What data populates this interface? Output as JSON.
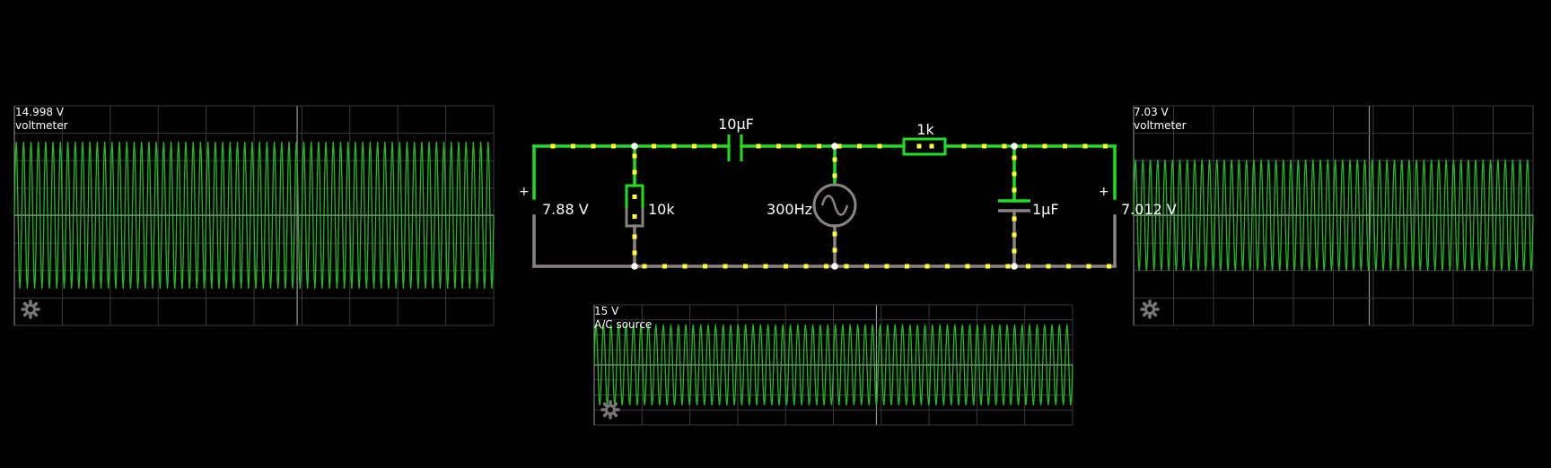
{
  "colors": {
    "background": "#000000",
    "wire_live": "#22dd22",
    "wire_ground": "#8a8280",
    "current_dot": "#ffff33",
    "node": "#ffffff",
    "scope_wave": "#22bb22",
    "scope_grid": "#3a3a3a",
    "scope_axis": "#999999",
    "scope_zero_line": "#bbbbbb",
    "gear": "#777777"
  },
  "scopes": [
    {
      "id": "left",
      "value": "14.998 V",
      "name": "voltmeter",
      "icon": "gear-icon"
    },
    {
      "id": "right",
      "value": "7.03 V",
      "name": "voltmeter",
      "icon": "gear-icon"
    },
    {
      "id": "bottom",
      "value": "15 V",
      "name": "A/C source",
      "icon": "gear-icon"
    }
  ],
  "circuit": {
    "meter_left_voltage": "7.88 V",
    "meter_right_voltage": "7.012 V",
    "meter_plus": "+",
    "capacitor_series": "10µF",
    "resistor_shunt": "10k",
    "source_freq": "300Hz",
    "resistor_series": "1k",
    "capacitor_shunt": "1µF"
  }
}
